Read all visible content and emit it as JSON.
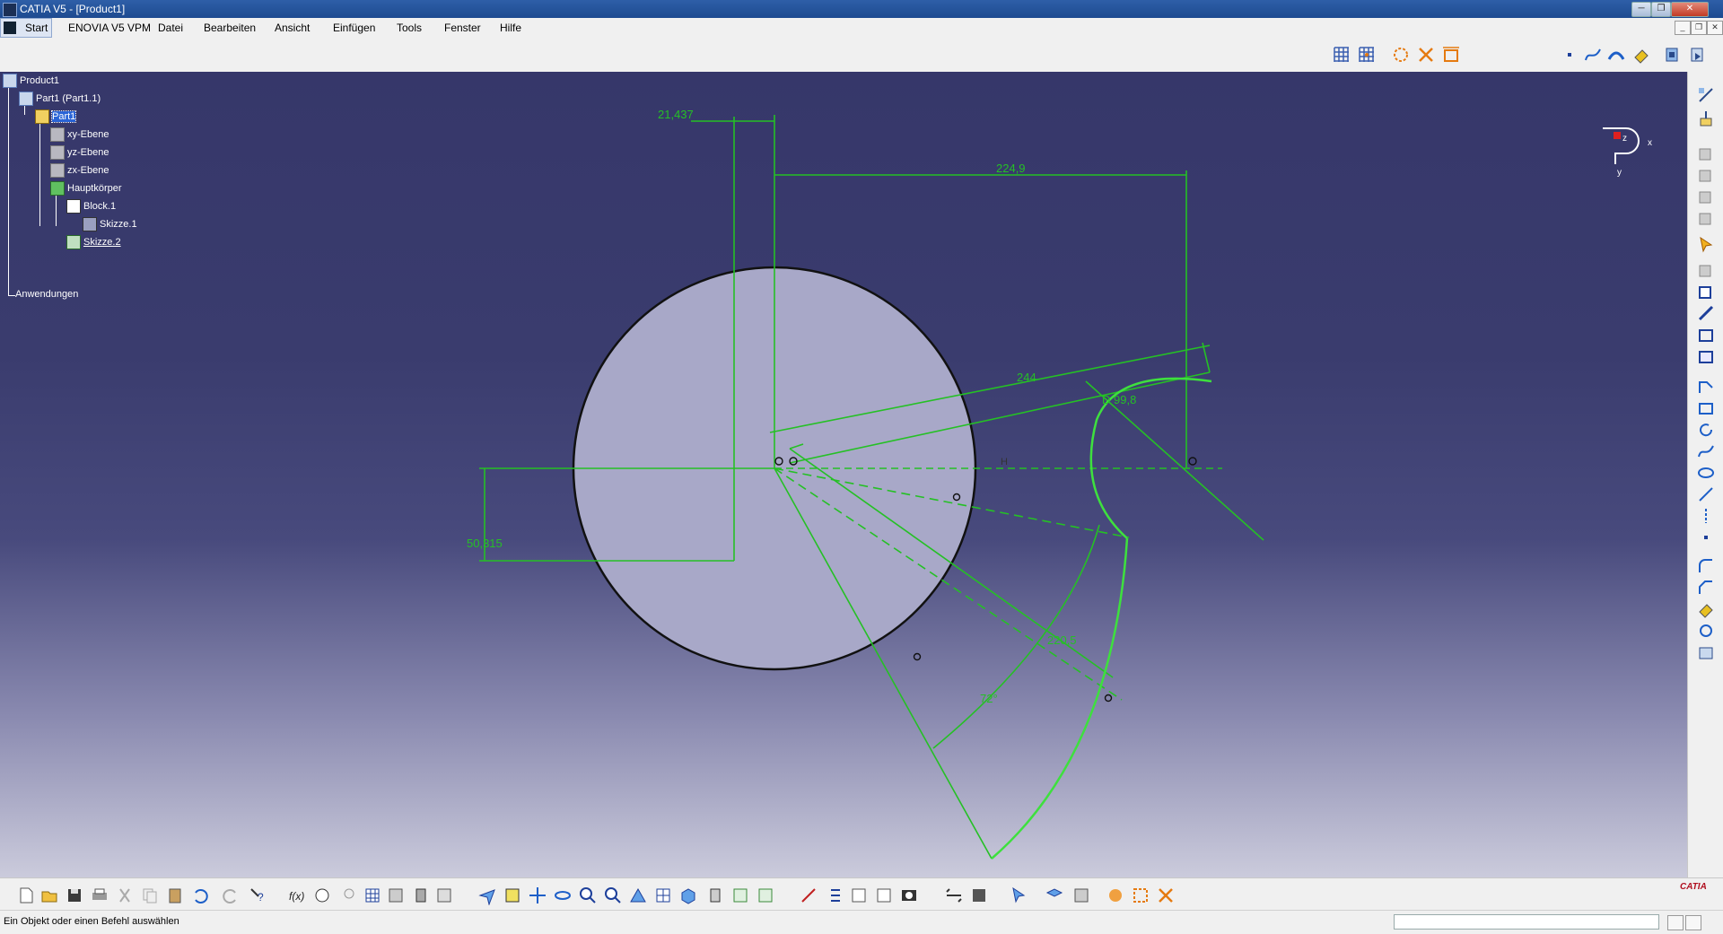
{
  "window": {
    "title": "CATIA V5 - [Product1]",
    "minimize": "─",
    "restore": "❐",
    "close": "✕"
  },
  "menu": {
    "start": "Start",
    "items": [
      "ENOVIA V5 VPM",
      "Datei",
      "Bearbeiten",
      "Ansicht",
      "Einfügen",
      "Tools",
      "Fenster",
      "Hilfe"
    ]
  },
  "tree": {
    "root": "Product1",
    "part_instance": "Part1 (Part1.1)",
    "part": "Part1",
    "planes": [
      "xy-Ebene",
      "yz-Ebene",
      "zx-Ebene"
    ],
    "body": "Hauptkörper",
    "pad": "Block.1",
    "sketch1": "Skizze.1",
    "sketch2": "Skizze.2",
    "applications": "Anwendungen"
  },
  "compass": {
    "x_label": "x",
    "y_label": "y",
    "z_label": "z"
  },
  "sketch": {
    "dimensions": {
      "d_top_offset": "21,437",
      "d_horizontal": "224,9",
      "d_long": "244",
      "d_arc_radius": "D 99,8",
      "d_vertical": "50,315",
      "d_radius": "220,5",
      "d_angle": "72°"
    },
    "constraint_h": "H"
  },
  "status": {
    "message": "Ein Objekt oder einen Befehl auswählen",
    "command_input": ""
  },
  "brand": {
    "logo_text": "CATIA"
  },
  "colors": {
    "sketch_green": "#25c025",
    "selected_green": "#3ee03e",
    "viewport_top": "#36376a",
    "viewport_bottom": "#cbcbdc",
    "circle_fill": "#a8a8c8"
  }
}
